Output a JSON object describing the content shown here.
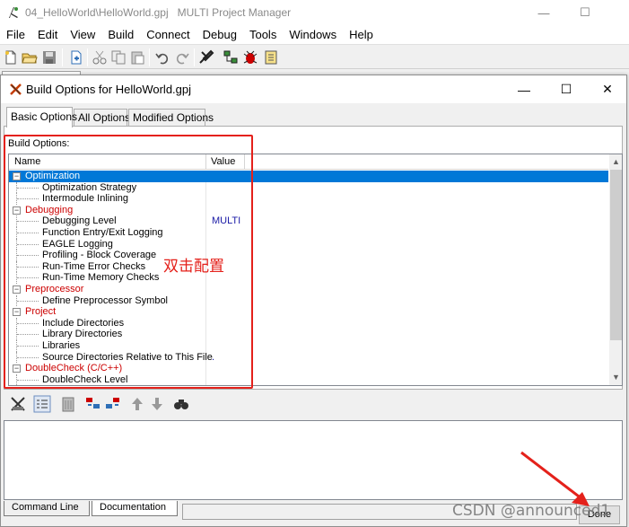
{
  "main_window": {
    "title": "04_HelloWorld\\HelloWorld.gpj   MULTI Project Manager",
    "controls": {
      "minimize": "—",
      "maximize": "☐"
    }
  },
  "menubar": [
    "File",
    "Edit",
    "View",
    "Build",
    "Connect",
    "Debug",
    "Tools",
    "Windows",
    "Help"
  ],
  "toolbar_icons": [
    "new-file-icon",
    "open-folder-icon",
    "save-icon",
    "add-file-icon",
    "cut-icon",
    "copy-icon",
    "paste-icon",
    "undo-icon",
    "redo-icon",
    "build-icon",
    "graph-icon",
    "debug-icon",
    "notes-icon"
  ],
  "dialog": {
    "title": "Build Options for HelloWorld.gpj",
    "controls": {
      "minimize": "—",
      "maximize": "☐",
      "close": "✕"
    },
    "tabs": [
      "Basic Options",
      "All Options",
      "Modified Options"
    ],
    "active_tab": "Basic Options",
    "build_options_label": "Build Options:",
    "columns": {
      "name": "Name",
      "value": "Value"
    },
    "tree": [
      {
        "kind": "category",
        "label": "Optimization",
        "selected": true,
        "expander": "⊟"
      },
      {
        "kind": "option",
        "label": "Optimization Strategy",
        "value": ""
      },
      {
        "kind": "option",
        "label": "Intermodule Inlining",
        "value": ""
      },
      {
        "kind": "category",
        "label": "Debugging",
        "expander": "⊟"
      },
      {
        "kind": "option",
        "label": "Debugging Level",
        "value": "MULTI"
      },
      {
        "kind": "option",
        "label": "Function Entry/Exit Logging",
        "value": ""
      },
      {
        "kind": "option",
        "label": "EAGLE Logging",
        "value": ""
      },
      {
        "kind": "option",
        "label": "Profiling - Block Coverage",
        "value": ""
      },
      {
        "kind": "option",
        "label": "Run-Time Error Checks",
        "value": ""
      },
      {
        "kind": "option",
        "label": "Run-Time Memory Checks",
        "value": ""
      },
      {
        "kind": "category",
        "label": "Preprocessor",
        "expander": "⊟"
      },
      {
        "kind": "option",
        "label": "Define Preprocessor Symbol",
        "value": ""
      },
      {
        "kind": "category",
        "label": "Project",
        "expander": "⊟"
      },
      {
        "kind": "option",
        "label": "Include Directories",
        "value": ""
      },
      {
        "kind": "option",
        "label": "Library Directories",
        "value": ""
      },
      {
        "kind": "option",
        "label": "Libraries",
        "value": ""
      },
      {
        "kind": "option",
        "label": "Source Directories Relative to This File",
        "value": "."
      },
      {
        "kind": "category",
        "label": "DoubleCheck (C/C++)",
        "expander": "⊟"
      },
      {
        "kind": "option",
        "label": "DoubleCheck Level",
        "value": ""
      }
    ],
    "scroll": {
      "up": "▲",
      "down": "▼"
    },
    "bottom_toolbar_icons": [
      "tree-view-icon",
      "list-view-icon",
      "delete-icon",
      "move-left-icon",
      "move-right-icon",
      "arrow-up-icon",
      "arrow-down-icon",
      "find-icon"
    ],
    "bottom_tabs": [
      "Command Line",
      "Documentation"
    ],
    "done_label": "Done"
  },
  "annotation": {
    "text": "双击配置",
    "color": "#e4211b"
  },
  "watermark": "CSDN @announced1",
  "colors": {
    "selection": "#0078d7",
    "category_text": "#cc0000",
    "value_text": "#1a1aa6",
    "annotation": "#e4211b"
  }
}
